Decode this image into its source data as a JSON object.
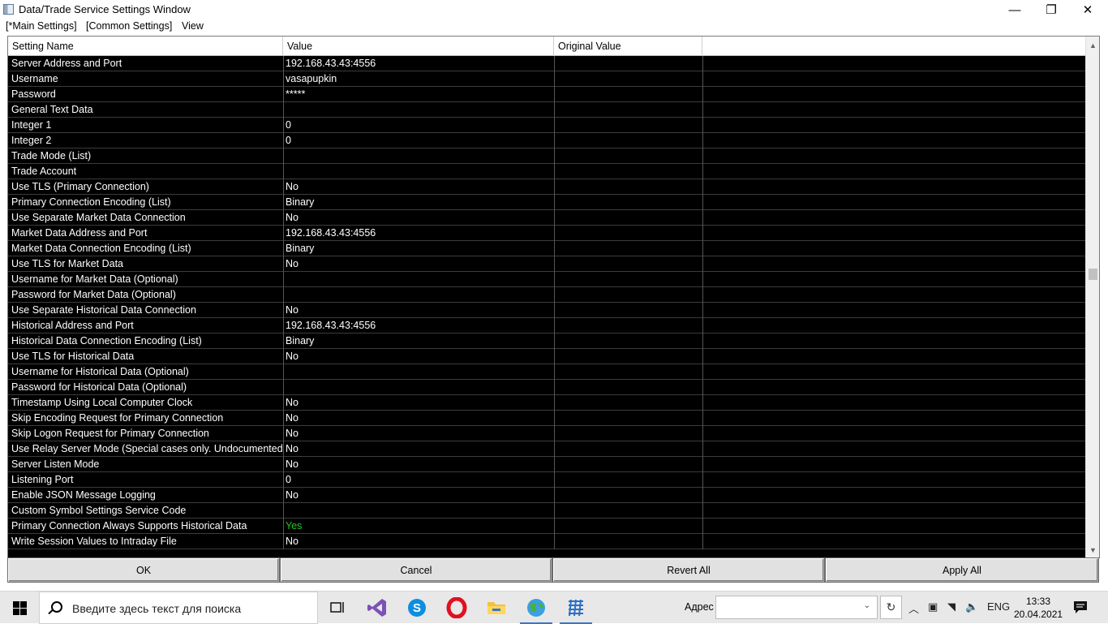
{
  "window": {
    "title": "Data/Trade Service Settings Window",
    "minimize_glyph": "—",
    "maximize_glyph": "❐",
    "close_glyph": "✕"
  },
  "menu": {
    "main_settings": "[*Main Settings]",
    "common_settings": "[Common Settings]",
    "view": "View"
  },
  "grid": {
    "headers": {
      "setting_name": "Setting Name",
      "value": "Value",
      "original_value": "Original Value"
    },
    "rows": [
      {
        "name": "Server Address and Port",
        "value": "192.168.43.43:4556"
      },
      {
        "name": "Username",
        "value": "vasapupkin"
      },
      {
        "name": "Password",
        "value": "*****"
      },
      {
        "name": "General Text Data",
        "value": ""
      },
      {
        "name": "Integer 1",
        "value": "0"
      },
      {
        "name": "Integer 2",
        "value": "0"
      },
      {
        "name": "Trade Mode (List)",
        "value": ""
      },
      {
        "name": "Trade Account",
        "value": ""
      },
      {
        "name": "Use TLS (Primary Connection)",
        "value": "No"
      },
      {
        "name": "Primary Connection Encoding (List)",
        "value": "Binary"
      },
      {
        "name": "Use Separate Market Data Connection",
        "value": "No"
      },
      {
        "name": "Market Data Address and Port",
        "value": "192.168.43.43:4556"
      },
      {
        "name": "Market Data Connection Encoding (List)",
        "value": "Binary"
      },
      {
        "name": "Use TLS for Market Data",
        "value": "No"
      },
      {
        "name": "Username for Market Data (Optional)",
        "value": ""
      },
      {
        "name": "Password for Market Data (Optional)",
        "value": ""
      },
      {
        "name": "Use Separate Historical Data Connection",
        "value": "No"
      },
      {
        "name": "Historical Address and Port",
        "value": "192.168.43.43:4556"
      },
      {
        "name": "Historical Data Connection Encoding (List)",
        "value": "Binary"
      },
      {
        "name": "Use TLS for Historical Data",
        "value": "No"
      },
      {
        "name": "Username for Historical Data (Optional)",
        "value": ""
      },
      {
        "name": "Password for Historical Data (Optional)",
        "value": ""
      },
      {
        "name": "Timestamp Using Local Computer Clock",
        "value": "No"
      },
      {
        "name": "Skip Encoding Request for Primary Connection",
        "value": "No"
      },
      {
        "name": "Skip Logon Request for Primary Connection",
        "value": "No"
      },
      {
        "name": "Use Relay Server Mode (Special cases only. Undocumented)",
        "value": "No"
      },
      {
        "name": "Server Listen Mode",
        "value": "No"
      },
      {
        "name": "Listening Port",
        "value": "0"
      },
      {
        "name": "Enable JSON Message Logging",
        "value": "No"
      },
      {
        "name": "Custom Symbol Settings Service Code",
        "value": ""
      },
      {
        "name": "Primary Connection Always Supports Historical Data",
        "value": "Yes",
        "value_color": "#22c722"
      },
      {
        "name": "Write Session Values to Intraday File",
        "value": "No"
      }
    ]
  },
  "buttons": {
    "ok": "OK",
    "cancel": "Cancel",
    "revert_all": "Revert All",
    "apply_all": "Apply All"
  },
  "taskbar": {
    "search_placeholder": "Введите здесь текст для поиска",
    "address_label": "Адрес",
    "address_value": "",
    "language": "ENG",
    "time": "13:33",
    "date": "20.04.2021"
  },
  "colors": {
    "grid_background": "#000000",
    "grid_text": "#ffffff",
    "highlight_value": "#22c722"
  }
}
